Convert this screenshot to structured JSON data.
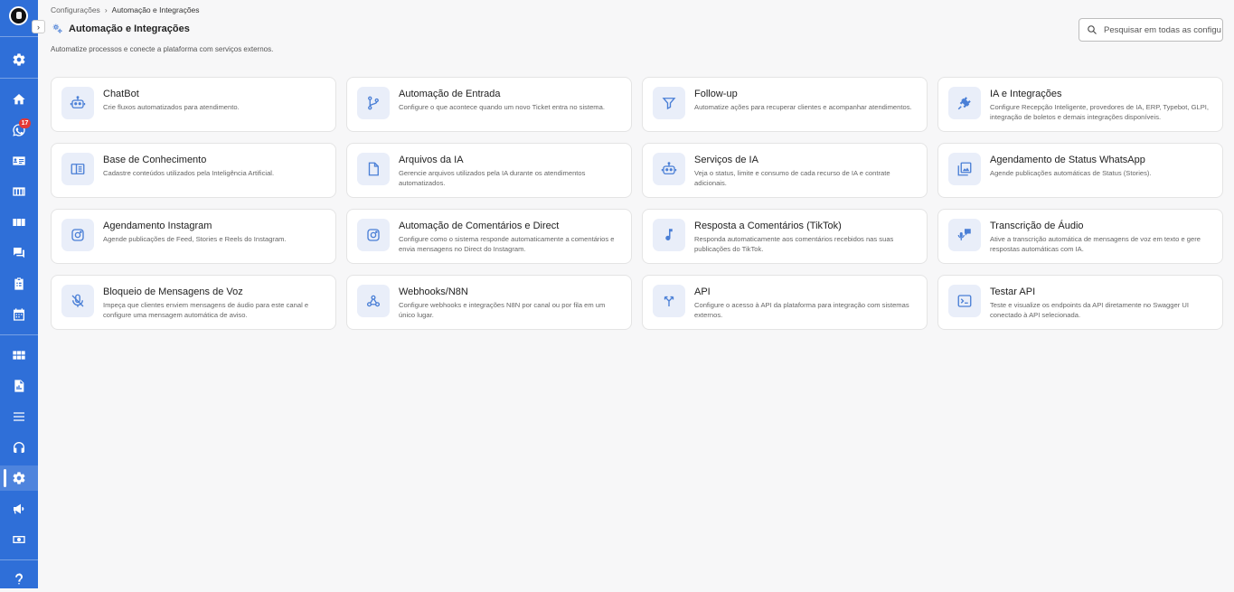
{
  "sidebar": {
    "badge_count": "17",
    "toggle_label": "›",
    "items": [
      {
        "name": "settings-top",
        "icon": "gear-icon"
      },
      {
        "name": "home",
        "icon": "home-icon"
      },
      {
        "name": "whatsapp",
        "icon": "whatsapp-icon"
      },
      {
        "name": "contacts",
        "icon": "id-card-icon"
      },
      {
        "name": "kanban",
        "icon": "kanban-icon"
      },
      {
        "name": "boards",
        "icon": "columns-icon"
      },
      {
        "name": "chats",
        "icon": "chat-icon"
      },
      {
        "name": "tasks",
        "icon": "clipboard-icon"
      },
      {
        "name": "calendar",
        "icon": "calendar-icon"
      },
      {
        "name": "dashboard",
        "icon": "dashboard-icon"
      },
      {
        "name": "reports",
        "icon": "report-icon"
      },
      {
        "name": "lists",
        "icon": "list-icon"
      },
      {
        "name": "support",
        "icon": "headset-icon"
      },
      {
        "name": "integrations",
        "icon": "gear-icon",
        "active": true
      },
      {
        "name": "campaigns",
        "icon": "megaphone-icon"
      },
      {
        "name": "finance",
        "icon": "money-icon"
      },
      {
        "name": "help",
        "icon": "help-icon"
      }
    ]
  },
  "breadcrumb": {
    "parent": "Configurações",
    "separator": "›",
    "current": "Automação e Integrações"
  },
  "header": {
    "title": "Automação e Integrações",
    "subtitle": "Automatize processos e conecte a plataforma com serviços externos."
  },
  "search": {
    "placeholder": "Pesquisar em todas as configurações"
  },
  "colors": {
    "sidebar": "#2f6fd8",
    "icon_accent": "#4a7fd6",
    "icon_bg": "#e9eef9"
  },
  "cards": [
    {
      "title": "ChatBot",
      "desc": "Crie fluxos automatizados para atendimento.",
      "icon": "robot-icon"
    },
    {
      "title": "Automação de Entrada",
      "desc": "Configure o que acontece quando um novo Ticket entra no sistema.",
      "icon": "branch-icon"
    },
    {
      "title": "Follow-up",
      "desc": "Automatize ações para recuperar clientes e acompanhar atendimentos.",
      "icon": "filter-icon"
    },
    {
      "title": "IA e Integrações",
      "desc": "Configure Recepção Inteligente, provedores de IA, ERP, Typebot, GLPI, integração de boletos e demais integrações disponíveis.",
      "icon": "plug-icon"
    },
    {
      "title": "Base de Conhecimento",
      "desc": "Cadastre conteúdos utilizados pela Inteligência Artificial.",
      "icon": "book-icon"
    },
    {
      "title": "Arquivos da IA",
      "desc": "Gerencie arquivos utilizados pela IA durante os atendimentos automatizados.",
      "icon": "file-icon"
    },
    {
      "title": "Serviços de IA",
      "desc": "Veja o status, limite e consumo de cada recurso de IA e contrate adicionais.",
      "icon": "robot-icon"
    },
    {
      "title": "Agendamento de Status WhatsApp",
      "desc": "Agende publicações automáticas de Status (Stories).",
      "icon": "image-stack-icon"
    },
    {
      "title": "Agendamento Instagram",
      "desc": "Agende publicações de Feed, Stories e Reels do Instagram.",
      "icon": "instagram-icon"
    },
    {
      "title": "Automação de Comentários e Direct",
      "desc": "Configure como o sistema responde automaticamente a comentários e envia mensagens no Direct do Instagram.",
      "icon": "instagram-icon"
    },
    {
      "title": "Resposta a Comentários (TikTok)",
      "desc": "Responda automaticamente aos comentários recebidos nas suas publicações do TikTok.",
      "icon": "music-note-icon"
    },
    {
      "title": "Transcrição de Áudio",
      "desc": "Ative a transcrição automática de mensagens de voz em texto e gere respostas automáticas com IA.",
      "icon": "voice-chat-icon"
    },
    {
      "title": "Bloqueio de Mensagens de Voz",
      "desc": "Impeça que clientes enviem mensagens de áudio para este canal e configure uma mensagem automática de aviso.",
      "icon": "mic-off-icon"
    },
    {
      "title": "Webhooks/N8N",
      "desc": "Configure webhooks e integrações N8N por canal ou por fila em um único lugar.",
      "icon": "webhook-icon"
    },
    {
      "title": "API",
      "desc": "Configure o acesso à API da plataforma para integração com sistemas externos.",
      "icon": "merge-icon"
    },
    {
      "title": "Testar API",
      "desc": "Teste e visualize os endpoints da API diretamente no Swagger UI conectado à API selecionada.",
      "icon": "terminal-icon"
    }
  ]
}
